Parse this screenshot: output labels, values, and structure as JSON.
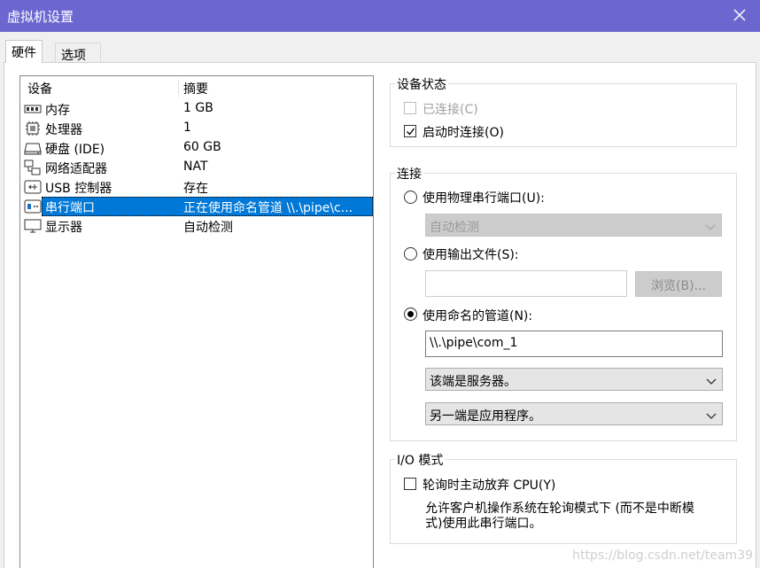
{
  "window": {
    "title": "虚拟机设置",
    "close_icon": "close-icon",
    "titlebar_color": "#6c67d0"
  },
  "tabs": [
    {
      "label": "硬件"
    },
    {
      "label": "选项"
    }
  ],
  "device_list": {
    "col_device": "设备",
    "col_summary": "摘要",
    "rows": [
      {
        "icon": "memory-icon",
        "name": "内存",
        "summary": "1 GB"
      },
      {
        "icon": "processor-icon",
        "name": "处理器",
        "summary": "1"
      },
      {
        "icon": "harddisk-icon",
        "name": "硬盘 (IDE)",
        "summary": "60 GB"
      },
      {
        "icon": "network-adapter-icon",
        "name": "网络适配器",
        "summary": "NAT"
      },
      {
        "icon": "usb-icon",
        "name": "USB 控制器",
        "summary": "存在"
      },
      {
        "icon": "serial-port-icon",
        "name": "串行端口",
        "summary": "正在使用命名管道 \\\\.\\pipe\\c..."
      },
      {
        "icon": "display-icon",
        "name": "显示器",
        "summary": "自动检测"
      }
    ],
    "selected_color": "#0078d7"
  },
  "device_status": {
    "title": "设备状态",
    "connected_label": "已连接(C)",
    "connect_at_power_on_label": "启动时连接(O)"
  },
  "connection": {
    "title": "连接",
    "physical_label": "使用物理串行端口(U):",
    "physical_combo": "自动检测",
    "output_file_label": "使用输出文件(S):",
    "output_file_value": "",
    "browse_button": "浏览(B)...",
    "named_pipe_label": "使用命名的管道(N):",
    "named_pipe_value": "\\\\.\\pipe\\com_1",
    "end_combo": "该端是服务器。",
    "other_end_combo": "另一端是应用程序。"
  },
  "io_mode": {
    "title": "I/O 模式",
    "yield_cpu_label": "轮询时主动放弃 CPU(Y)",
    "description_line1": "允许客户机操作系统在轮询模式下 (而不是中断模",
    "description_line2": "式)使用此串行端口。"
  },
  "watermark": "https://blog.csdn.net/team39"
}
